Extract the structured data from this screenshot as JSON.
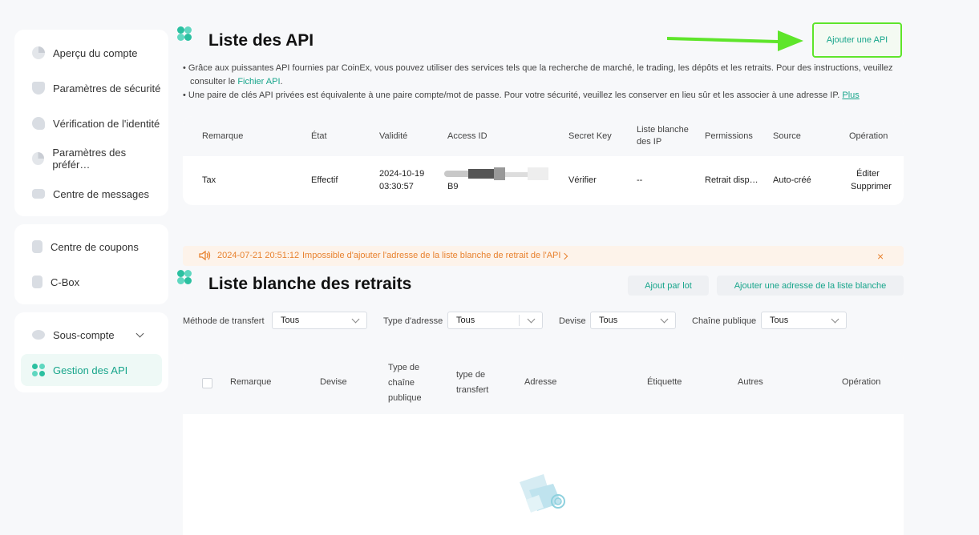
{
  "sidebar": {
    "group1": [
      {
        "label": "Aperçu du compte",
        "icon": "pie-chart-icon"
      },
      {
        "label": "Paramètres de sécurité",
        "icon": "shield-icon"
      },
      {
        "label": "Vérification de l'identité",
        "icon": "id-badge-icon"
      },
      {
        "label": "Paramètres des préfér…",
        "icon": "preferences-icon"
      },
      {
        "label": "Centre de messages",
        "icon": "message-icon"
      }
    ],
    "group2": [
      {
        "label": "Centre de coupons",
        "icon": "coupon-icon"
      },
      {
        "label": "C-Box",
        "icon": "box-icon"
      }
    ],
    "group3": [
      {
        "label": "Sous-compte",
        "icon": "subaccount-icon"
      },
      {
        "label": "Gestion des API",
        "icon": "api-clover-icon"
      }
    ]
  },
  "api_section": {
    "title": "Liste des API",
    "add_button": "Ajouter une API",
    "desc1_text": "Grâce aux puissantes API fournies par CoinEx, vous pouvez utiliser des services tels que la recherche de marché, le trading, les dépôts et les retraits. Pour des instructions, veuillez consulter le",
    "desc1_link": "Fichier API",
    "desc1_end": ".",
    "desc2_text": "Une paire de clés API privées est équivalente à une paire compte/mot de passe. Pour votre sécurité, veuillez les conserver en lieu sûr et les associer à une adresse IP.",
    "desc2_link": "Plus",
    "headers": {
      "remark": "Remarque",
      "state": "État",
      "validity": "Validité",
      "access_id": "Access ID",
      "secret_key": "Secret Key",
      "whitelist_l1": "Liste blanche",
      "whitelist_l2": "des IP",
      "permissions": "Permissions",
      "source": "Source",
      "operation": "Opération"
    },
    "row": {
      "remark": "Tax",
      "state": "Effectif",
      "validity_date": "2024-10-19",
      "validity_time": "03:30:57",
      "access_id_suffix": "B9",
      "secret_key": "Vérifier",
      "whitelist": "--",
      "permissions": "Retrait disp…",
      "source": "Auto-créé",
      "op_edit": "Éditer",
      "op_delete": "Supprimer"
    }
  },
  "notice": {
    "datetime": "2024-07-21 20:51:12",
    "message": "Impossible d'ajouter l'adresse de la liste blanche de retrait de l'API",
    "close": "×"
  },
  "whitelist_section": {
    "title": "Liste blanche des retraits",
    "batch_button": "Ajout par lot",
    "add_button": "Ajouter une adresse de la liste blanche",
    "filters": [
      {
        "label": "Méthode de transfert",
        "value": "Tous"
      },
      {
        "label": "Type d'adresse",
        "value": "Tous"
      },
      {
        "label": "Devise",
        "value": "Tous"
      },
      {
        "label": "Chaîne publique",
        "value": "Tous"
      }
    ],
    "headers": {
      "remark": "Remarque",
      "currency": "Devise",
      "chain_l1": "Type de",
      "chain_l2": "chaîne",
      "chain_l3": "publique",
      "transfer_l1": "type de",
      "transfer_l2": "transfert",
      "address": "Adresse",
      "tag": "Étiquette",
      "others": "Autres",
      "operation": "Opération"
    }
  },
  "colors": {
    "accent": "#17a58b",
    "highlight_arrow": "#5ee52a",
    "notice_text": "#e8822f"
  }
}
